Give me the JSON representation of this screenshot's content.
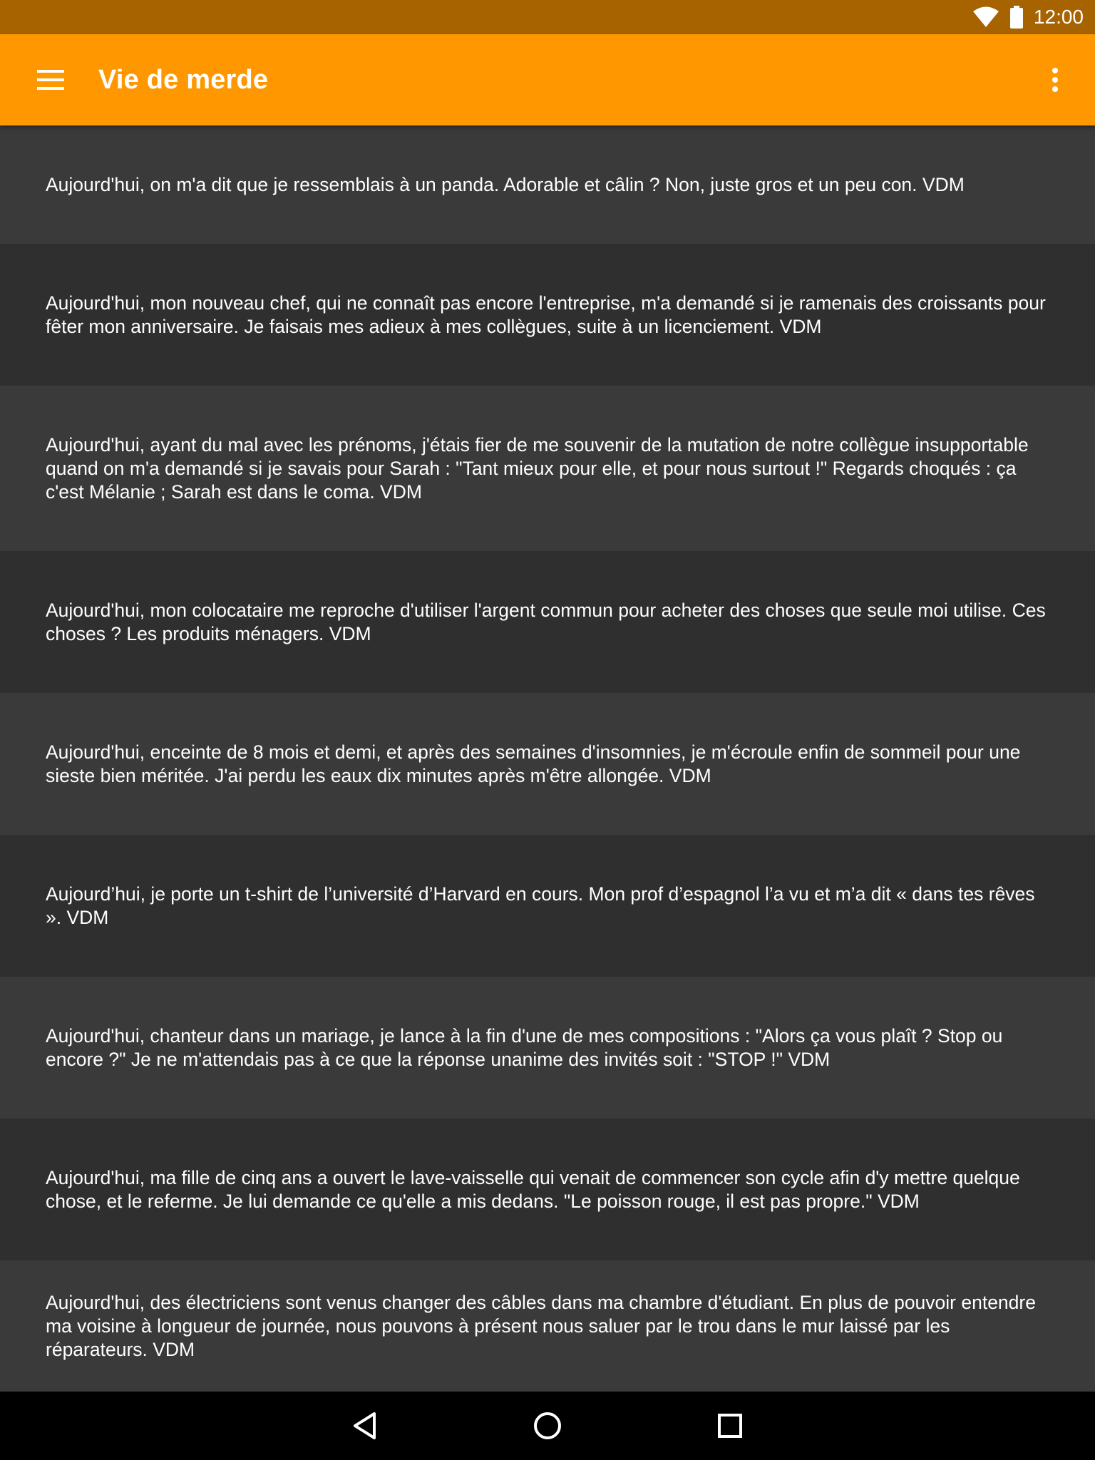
{
  "status_bar": {
    "time": "12:00"
  },
  "app_bar": {
    "title": "Vie de merde"
  },
  "posts": [
    "Aujourd'hui, on m'a dit que je ressemblais à un panda. Adorable et câlin ? Non, juste gros et un peu con. VDM",
    "Aujourd'hui, mon nouveau chef, qui ne connaît pas encore l'entreprise, m'a demandé si je ramenais des croissants pour fêter mon anniversaire. Je faisais mes adieux à mes collègues, suite à un licenciement. VDM",
    "Aujourd'hui, ayant du mal avec les prénoms, j'étais fier de me souvenir de la mutation de notre collègue insupportable quand on m'a demandé si je savais pour Sarah : \"Tant mieux pour elle, et pour nous surtout !\" Regards choqués : ça c'est Mélanie ; Sarah est dans le coma. VDM",
    "Aujourd'hui, mon colocataire me reproche d'utiliser l'argent commun pour acheter des choses que seule moi utilise. Ces choses ? Les produits ménagers. VDM",
    "Aujourd'hui, enceinte de 8 mois et demi, et après des semaines d'insomnies, je m'écroule enfin de sommeil pour une sieste bien méritée. J'ai perdu les eaux dix minutes après m'être allongée. VDM",
    "Aujourd’hui, je porte un t-shirt de l’université d’Harvard en cours. Mon prof d’espagnol l’a vu et m’a dit « dans tes rêves ». VDM",
    "Aujourd'hui, chanteur dans un mariage, je lance à la fin d'une de mes compositions : \"Alors ça vous plaît ? Stop ou encore ?\" Je ne m'attendais pas à ce que la réponse unanime des invités soit : \"STOP !\" VDM",
    "Aujourd'hui, ma fille de cinq ans a ouvert le lave-vaisselle qui venait de commencer son cycle afin d'y mettre quelque chose, et le referme. Je lui demande ce qu'elle a mis dedans. \"Le poisson rouge, il est pas propre.\" VDM",
    "Aujourd'hui, des électriciens sont venus changer des câbles dans ma chambre d'étudiant. En plus de pouvoir entendre ma voisine à longueur de journée, nous pouvons à présent nous saluer par le trou dans le mur laissé par les réparateurs. VDM"
  ],
  "icons": {
    "menu": "hamburger-menu-icon",
    "overflow": "more-vert-icon",
    "wifi": "wifi-icon",
    "battery": "battery-icon",
    "back": "back-triangle-icon",
    "home": "home-circle-icon",
    "recents": "recents-square-icon"
  },
  "colors": {
    "status_bar": "#A66300",
    "app_bar": "#FF9800",
    "row_light": "#3A3A3A",
    "row_dark": "#2F2F2F",
    "nav_bar": "#000000",
    "text": "#FFFFFF"
  }
}
